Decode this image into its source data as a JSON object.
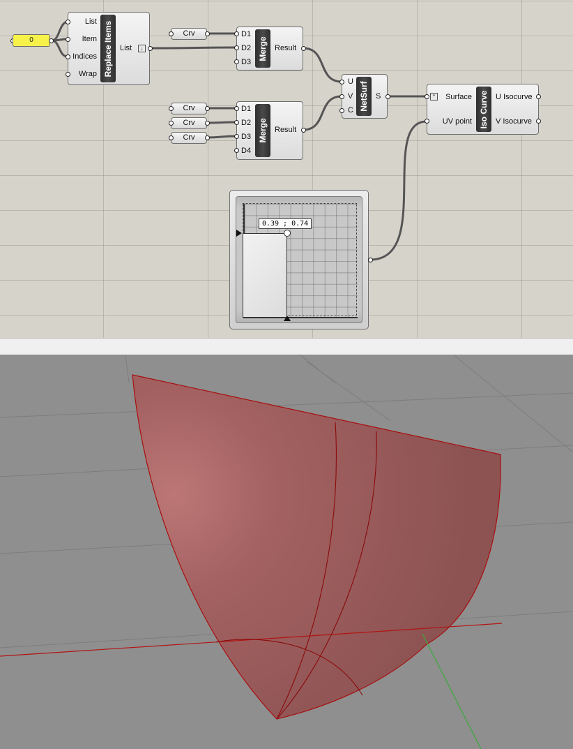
{
  "canvas": {
    "slider": {
      "value": "0"
    },
    "replace_items": {
      "title": "Replace Items",
      "inputs": [
        "List",
        "Item",
        "Indices",
        "Wrap"
      ],
      "output": "List"
    },
    "crv_param": {
      "label": "Crv"
    },
    "merge_1": {
      "title": "Merge",
      "inputs": [
        "D1",
        "D2",
        "D3"
      ],
      "output": "Result"
    },
    "merge_2": {
      "title": "Merge",
      "inputs": [
        "D1",
        "D2",
        "D3",
        "D4"
      ],
      "output": "Result"
    },
    "crv_params_2": [
      "Crv",
      "Crv",
      "Crv"
    ],
    "netsurf": {
      "title": "NetSurf",
      "inputs": [
        "U",
        "V",
        "C"
      ],
      "output": "S"
    },
    "iso_curve": {
      "title": "Iso Curve",
      "inputs": [
        "Surface",
        "UV point"
      ],
      "outputs": [
        "U Isocurve",
        "V Isocurve"
      ]
    },
    "md_slider": {
      "label": "0.39 ; 0.74",
      "u": 0.39,
      "v": 0.74
    }
  },
  "colors": {
    "canvas_bg": "#d6d3cb",
    "slider_yellow": "#f7f24a",
    "viewport_bg": "#8f8f8f",
    "surface_fill": "#b35c5c",
    "surface_edge": "#a80f0f",
    "x_axis": "#b31414",
    "y_axis": "#3aa83a"
  }
}
